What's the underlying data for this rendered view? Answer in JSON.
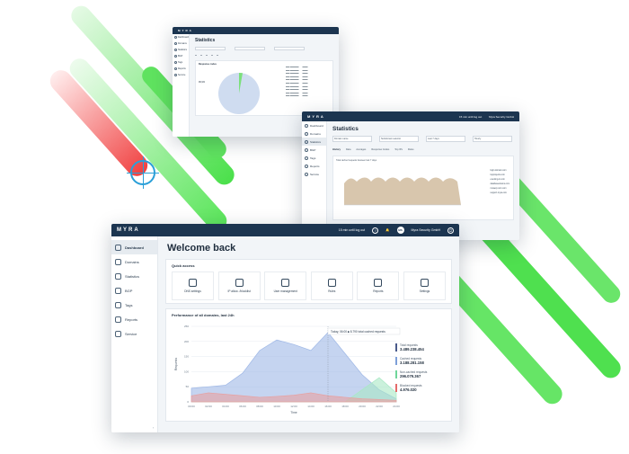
{
  "brand": "MYRA",
  "window1": {
    "title": "Statistics",
    "nav": [
      "Dashboard",
      "Domains",
      "Statistics",
      "BGP",
      "Tags",
      "Reports",
      "Service"
    ],
    "panel_title": "Response codes",
    "ratio": "99,9%"
  },
  "window2": {
    "title": "Statistics",
    "session": "15 min until log out",
    "org": "Myra Security GmbH",
    "nav": [
      "Dashboard",
      "Domains",
      "Statistics",
      "BGP",
      "Tags",
      "Reports",
      "Service"
    ],
    "filters": [
      "Domain name",
      "Subdomain selector",
      "Last 7 days",
      "Hourly"
    ],
    "tabs": [
      "History",
      "Data",
      "Averages",
      "Response Codes",
      "Top IPs",
      "Rules"
    ],
    "chart_title": "Total cached requests between last 7 days",
    "legend": [
      "login.domain.com",
      "topprojects.com",
      "eventing-in.com",
      "databasevisions.com",
      "mcaexp.com.com",
      "support.myra.com"
    ]
  },
  "main": {
    "session": "15 min until log out",
    "org": "Myra Security GmbH",
    "title": "Welcome back",
    "nav": [
      {
        "label": "Dashboard",
        "icon": "dashboard-icon"
      },
      {
        "label": "Domains",
        "icon": "domains-icon"
      },
      {
        "label": "Statistics",
        "icon": "statistics-icon"
      },
      {
        "label": "BGP",
        "icon": "bgp-icon"
      },
      {
        "label": "Tags",
        "icon": "tags-icon"
      },
      {
        "label": "Reports",
        "icon": "reports-icon"
      },
      {
        "label": "Service",
        "icon": "service-icon"
      }
    ],
    "quick_access_title": "Quick access",
    "quick_access": [
      {
        "label": "DNS settings",
        "icon": "dns-icon"
      },
      {
        "label": "IP allow- /blocklist",
        "icon": "ip-list-icon"
      },
      {
        "label": "User management",
        "icon": "users-icon"
      },
      {
        "label": "Rules",
        "icon": "rules-icon"
      },
      {
        "label": "Reports",
        "icon": "reports-icon"
      },
      {
        "label": "Settings",
        "icon": "settings-icon"
      }
    ],
    "perf_title": "Performance of all domains, last 24h",
    "tooltip": "Today, 06:00 ■ 8.790 total cached requests",
    "stats": [
      {
        "label": "Total requests",
        "value": "3.489.238.454"
      },
      {
        "label": "Cached requests",
        "value": "3.188.281.158"
      },
      {
        "label": "Non-cached requests",
        "value": "296.079.367"
      },
      {
        "label": "Blocked requests",
        "value": "4.976.020"
      }
    ]
  },
  "chart_data": {
    "type": "area",
    "xlabel": "Time",
    "ylabel": "Requests",
    "x": [
      "00:00",
      "02:00",
      "04:00",
      "06:00",
      "08:00",
      "10:00",
      "12:00",
      "14:00",
      "16:00",
      "18:00",
      "20:00",
      "22:00",
      "24:00"
    ],
    "yticks": [
      "0",
      "50",
      "100",
      "150",
      "200",
      "250"
    ],
    "series": [
      {
        "name": "Cached requests",
        "color": "#9fb8e6",
        "values": [
          45,
          50,
          55,
          95,
          170,
          205,
          190,
          170,
          230,
          160,
          90,
          40,
          10
        ]
      },
      {
        "name": "Non-cached requests",
        "color": "#a8e8c4",
        "values": [
          0,
          0,
          0,
          0,
          0,
          0,
          0,
          0,
          0,
          0,
          40,
          80,
          30
        ]
      },
      {
        "name": "Blocked requests",
        "color": "#e8a0a0",
        "values": [
          20,
          30,
          25,
          20,
          15,
          18,
          22,
          30,
          20,
          15,
          10,
          8,
          5
        ]
      }
    ],
    "ylim": [
      0,
      250
    ]
  },
  "colors": {
    "navbar": "#1c3550",
    "streak_green": "#4be04b",
    "streak_red": "#f04040",
    "target": "#2a9fd8"
  }
}
